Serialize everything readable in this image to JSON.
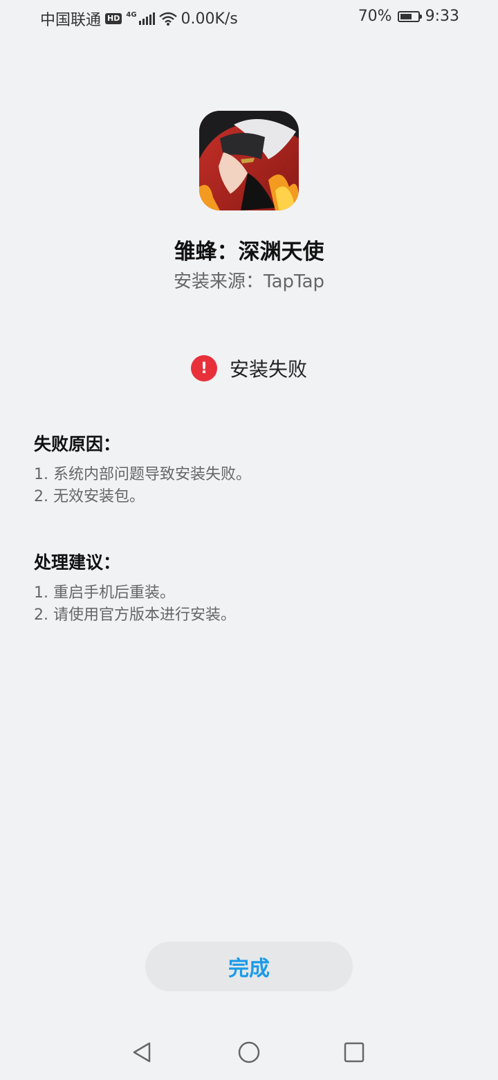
{
  "status_bar": {
    "carrier": "中国联通",
    "hd": "HD",
    "network": "4G",
    "speed": "0.00K/s",
    "battery_percent": "70%",
    "battery_level": 0.7,
    "time": "9:33"
  },
  "app": {
    "name": "雏蜂：深渊天使",
    "source": "安装来源：TapTap",
    "icon": "app-icon-game-character"
  },
  "result": {
    "icon": "error-icon",
    "text": "安装失败",
    "color": "#e8303a"
  },
  "failure_reasons": {
    "title": "失败原因：",
    "items": [
      "1. 系统内部问题导致安装失败。",
      "2. 无效安装包。"
    ]
  },
  "suggestions": {
    "title": "处理建议：",
    "items": [
      "1. 重启手机后重装。",
      "2. 请使用官方版本进行安装。"
    ]
  },
  "done_button": {
    "label": "完成",
    "color": "#1a9be8"
  },
  "nav_bar": {
    "back": "back-triangle-icon",
    "home": "home-circle-icon",
    "recents": "recents-square-icon"
  }
}
